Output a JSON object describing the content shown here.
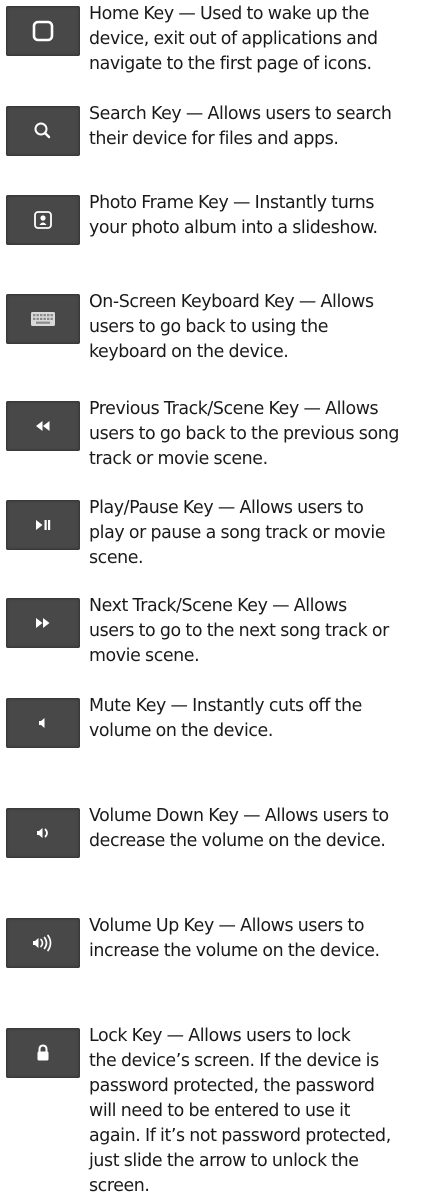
{
  "keys": [
    {
      "icon": "home-icon",
      "text": "Home Key — Used to wake up the\ndevice, exit out of applications and\nnavigate to the first page of icons."
    },
    {
      "icon": "search-icon",
      "text": "Search Key — Allows users to search\ntheir device for files and apps."
    },
    {
      "icon": "photo-frame-icon",
      "text": "Photo Frame Key — Instantly turns\nyour photo album into a slideshow."
    },
    {
      "icon": "keyboard-icon",
      "text": "On-Screen Keyboard Key — Allows\nusers to go back to using the\nkeyboard on the device."
    },
    {
      "icon": "rewind-icon",
      "text": "Previous Track/Scene Key — Allows\nusers to go back to the previous song\ntrack or movie scene."
    },
    {
      "icon": "play-pause-icon",
      "text": "Play/Pause Key — Allows users to\nplay or pause a song track or movie\nscene."
    },
    {
      "icon": "fast-forward-icon",
      "text": "Next Track/Scene Key — Allows\nusers to go to the next song track or\nmovie scene."
    },
    {
      "icon": "mute-icon",
      "text": "Mute Key — Instantly cuts off the\nvolume on the device."
    },
    {
      "icon": "volume-down-icon",
      "text": "Volume Down Key — Allows users to\ndecrease the volume on the device."
    },
    {
      "icon": "volume-up-icon",
      "text": "Volume Up Key — Allows users to\nincrease the volume on the device."
    },
    {
      "icon": "lock-icon",
      "text": "Lock Key — Allows users to lock\nthe device’s screen. If the device is\npassword protected, the password\nwill need to be entered to use it\nagain. If it’s not password protected,\njust slide the arrow to unlock the\nscreen."
    }
  ]
}
